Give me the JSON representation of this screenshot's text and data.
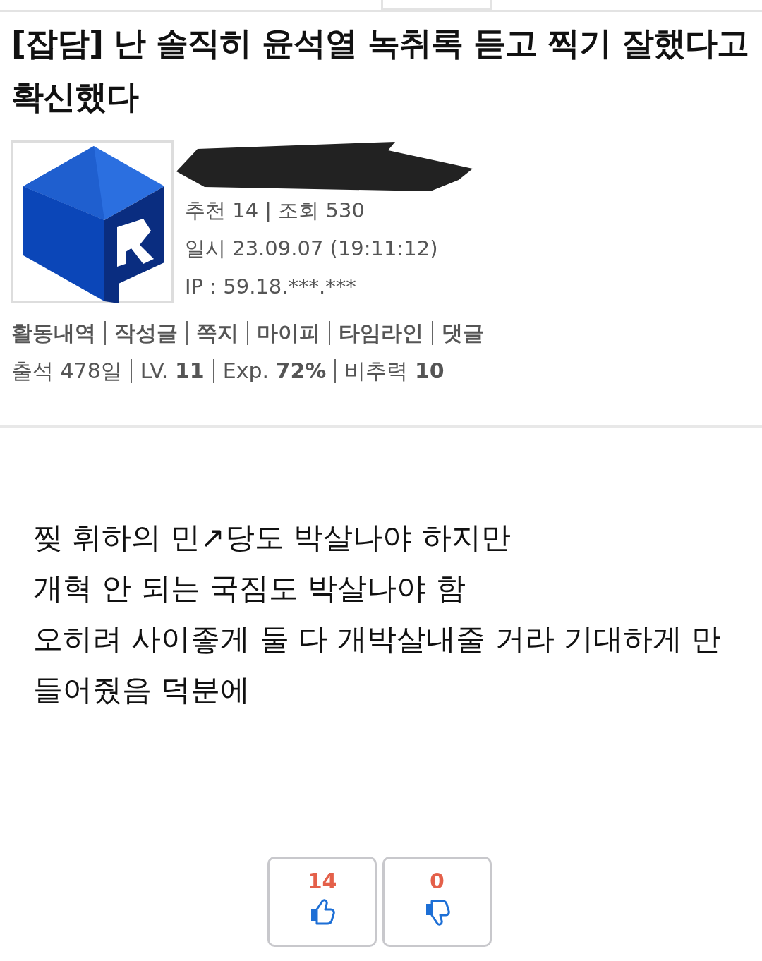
{
  "title": "[잡담] 난 솔직히 윤석열 녹취록 듣고 찍기 잘했다고 확신했다",
  "author": {
    "redacted": true,
    "meta": [
      "추천 14 | 조회 530",
      "일시 23.09.07 (19:11:12)",
      "IP : 59.18.***.***"
    ]
  },
  "links": [
    "활동내역",
    "작성글",
    "쪽지",
    "마이피",
    "타임라인",
    "댓글"
  ],
  "stats": [
    {
      "label": "출석",
      "value": "478일",
      "bold": false
    },
    {
      "label": "LV.",
      "value": "11",
      "bold": true
    },
    {
      "label": "Exp.",
      "value": "72%",
      "bold": true
    },
    {
      "label": "비추력",
      "value": "10",
      "bold": true
    }
  ],
  "body": [
    "찢 휘하의 민↗당도 박살나야 하지만",
    "개혁 안 되는 국짐도 박살나야 함",
    "오히려 사이좋게 둘 다 개박살내줄 거라 기대하게 만",
    "들어줬음 덕분에"
  ],
  "votes": [
    {
      "kind": "up",
      "count": "14"
    },
    {
      "kind": "down",
      "count": "0"
    }
  ]
}
